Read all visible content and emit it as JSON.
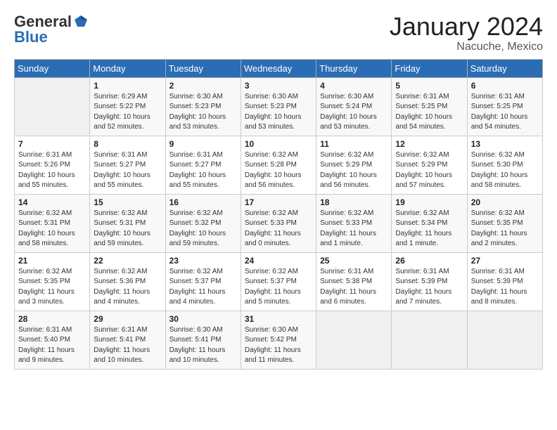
{
  "logo": {
    "general": "General",
    "blue": "Blue"
  },
  "title": "January 2024",
  "location": "Nacuche, Mexico",
  "days_of_week": [
    "Sunday",
    "Monday",
    "Tuesday",
    "Wednesday",
    "Thursday",
    "Friday",
    "Saturday"
  ],
  "weeks": [
    [
      {
        "day": "",
        "info": ""
      },
      {
        "day": "1",
        "info": "Sunrise: 6:29 AM\nSunset: 5:22 PM\nDaylight: 10 hours\nand 52 minutes."
      },
      {
        "day": "2",
        "info": "Sunrise: 6:30 AM\nSunset: 5:23 PM\nDaylight: 10 hours\nand 53 minutes."
      },
      {
        "day": "3",
        "info": "Sunrise: 6:30 AM\nSunset: 5:23 PM\nDaylight: 10 hours\nand 53 minutes."
      },
      {
        "day": "4",
        "info": "Sunrise: 6:30 AM\nSunset: 5:24 PM\nDaylight: 10 hours\nand 53 minutes."
      },
      {
        "day": "5",
        "info": "Sunrise: 6:31 AM\nSunset: 5:25 PM\nDaylight: 10 hours\nand 54 minutes."
      },
      {
        "day": "6",
        "info": "Sunrise: 6:31 AM\nSunset: 5:25 PM\nDaylight: 10 hours\nand 54 minutes."
      }
    ],
    [
      {
        "day": "7",
        "info": "Sunrise: 6:31 AM\nSunset: 5:26 PM\nDaylight: 10 hours\nand 55 minutes."
      },
      {
        "day": "8",
        "info": "Sunrise: 6:31 AM\nSunset: 5:27 PM\nDaylight: 10 hours\nand 55 minutes."
      },
      {
        "day": "9",
        "info": "Sunrise: 6:31 AM\nSunset: 5:27 PM\nDaylight: 10 hours\nand 55 minutes."
      },
      {
        "day": "10",
        "info": "Sunrise: 6:32 AM\nSunset: 5:28 PM\nDaylight: 10 hours\nand 56 minutes."
      },
      {
        "day": "11",
        "info": "Sunrise: 6:32 AM\nSunset: 5:29 PM\nDaylight: 10 hours\nand 56 minutes."
      },
      {
        "day": "12",
        "info": "Sunrise: 6:32 AM\nSunset: 5:29 PM\nDaylight: 10 hours\nand 57 minutes."
      },
      {
        "day": "13",
        "info": "Sunrise: 6:32 AM\nSunset: 5:30 PM\nDaylight: 10 hours\nand 58 minutes."
      }
    ],
    [
      {
        "day": "14",
        "info": "Sunrise: 6:32 AM\nSunset: 5:31 PM\nDaylight: 10 hours\nand 58 minutes."
      },
      {
        "day": "15",
        "info": "Sunrise: 6:32 AM\nSunset: 5:31 PM\nDaylight: 10 hours\nand 59 minutes."
      },
      {
        "day": "16",
        "info": "Sunrise: 6:32 AM\nSunset: 5:32 PM\nDaylight: 10 hours\nand 59 minutes."
      },
      {
        "day": "17",
        "info": "Sunrise: 6:32 AM\nSunset: 5:33 PM\nDaylight: 11 hours\nand 0 minutes."
      },
      {
        "day": "18",
        "info": "Sunrise: 6:32 AM\nSunset: 5:33 PM\nDaylight: 11 hours\nand 1 minute."
      },
      {
        "day": "19",
        "info": "Sunrise: 6:32 AM\nSunset: 5:34 PM\nDaylight: 11 hours\nand 1 minute."
      },
      {
        "day": "20",
        "info": "Sunrise: 6:32 AM\nSunset: 5:35 PM\nDaylight: 11 hours\nand 2 minutes."
      }
    ],
    [
      {
        "day": "21",
        "info": "Sunrise: 6:32 AM\nSunset: 5:35 PM\nDaylight: 11 hours\nand 3 minutes."
      },
      {
        "day": "22",
        "info": "Sunrise: 6:32 AM\nSunset: 5:36 PM\nDaylight: 11 hours\nand 4 minutes."
      },
      {
        "day": "23",
        "info": "Sunrise: 6:32 AM\nSunset: 5:37 PM\nDaylight: 11 hours\nand 4 minutes."
      },
      {
        "day": "24",
        "info": "Sunrise: 6:32 AM\nSunset: 5:37 PM\nDaylight: 11 hours\nand 5 minutes."
      },
      {
        "day": "25",
        "info": "Sunrise: 6:31 AM\nSunset: 5:38 PM\nDaylight: 11 hours\nand 6 minutes."
      },
      {
        "day": "26",
        "info": "Sunrise: 6:31 AM\nSunset: 5:39 PM\nDaylight: 11 hours\nand 7 minutes."
      },
      {
        "day": "27",
        "info": "Sunrise: 6:31 AM\nSunset: 5:39 PM\nDaylight: 11 hours\nand 8 minutes."
      }
    ],
    [
      {
        "day": "28",
        "info": "Sunrise: 6:31 AM\nSunset: 5:40 PM\nDaylight: 11 hours\nand 9 minutes."
      },
      {
        "day": "29",
        "info": "Sunrise: 6:31 AM\nSunset: 5:41 PM\nDaylight: 11 hours\nand 10 minutes."
      },
      {
        "day": "30",
        "info": "Sunrise: 6:30 AM\nSunset: 5:41 PM\nDaylight: 11 hours\nand 10 minutes."
      },
      {
        "day": "31",
        "info": "Sunrise: 6:30 AM\nSunset: 5:42 PM\nDaylight: 11 hours\nand 11 minutes."
      },
      {
        "day": "",
        "info": ""
      },
      {
        "day": "",
        "info": ""
      },
      {
        "day": "",
        "info": ""
      }
    ]
  ]
}
